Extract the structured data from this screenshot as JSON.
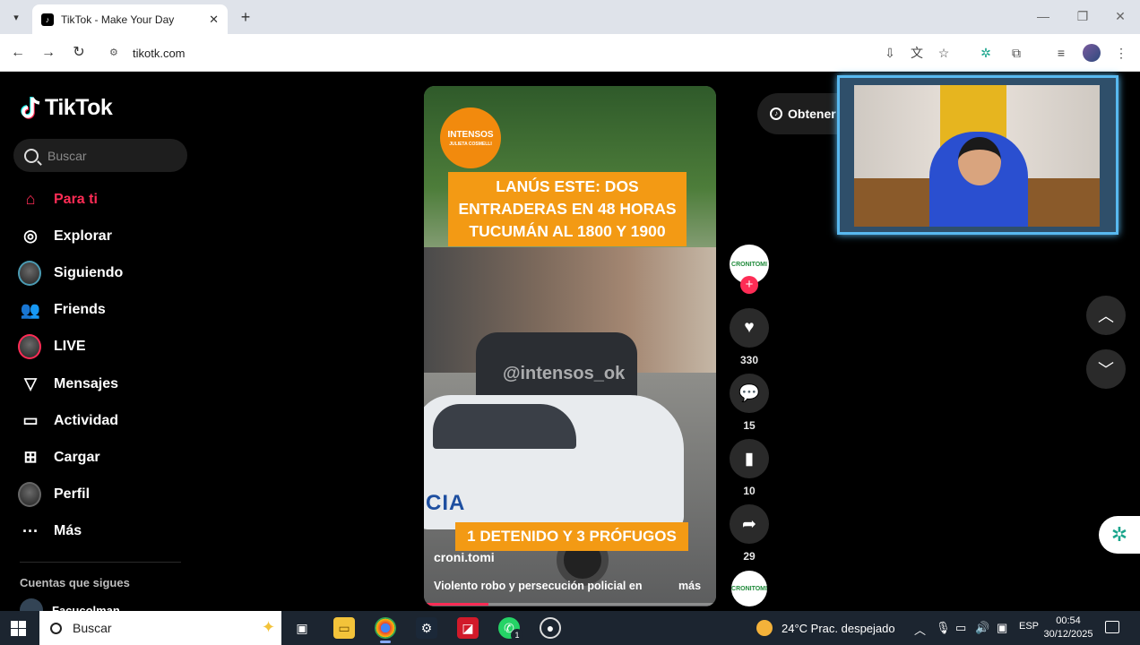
{
  "browser": {
    "tab_title": "TikTok - Make Your Day",
    "url": "tikotk.com"
  },
  "sidebar": {
    "logo": "TikTok",
    "search_placeholder": "Buscar",
    "items": [
      {
        "label": "Para ti",
        "icon": "home-icon",
        "active": true
      },
      {
        "label": "Explorar",
        "icon": "compass-icon"
      },
      {
        "label": "Siguiendo",
        "icon": "following-avatar-icon"
      },
      {
        "label": "Friends",
        "icon": "friends-icon"
      },
      {
        "label": "LIVE",
        "icon": "live-avatar-icon"
      },
      {
        "label": "Mensajes",
        "icon": "send-icon"
      },
      {
        "label": "Actividad",
        "icon": "activity-icon"
      },
      {
        "label": "Cargar",
        "icon": "upload-icon"
      },
      {
        "label": "Perfil",
        "icon": "profile-avatar-icon"
      },
      {
        "label": "Más",
        "icon": "more-icon"
      }
    ],
    "following_title": "Cuentas que sigues",
    "following_users": [
      "Facucolman"
    ]
  },
  "video": {
    "brand_badge": "INTENSOS",
    "brand_badge_sub": "JULIETA COSMELLI",
    "headline": "LANÚS ESTE: DOS ENTRADERAS EN 48 HORAS TUCUMÁN AL 1800 Y 1900",
    "watermark": "@intensos_ok",
    "police_text": "CIA",
    "lower_banner": "1 DETENIDO Y 3 PRÓFUGOS",
    "author": "croni.tomi",
    "description": "Violento robo y persecución policial en",
    "more_label": "más",
    "progress": 0.22
  },
  "actions": {
    "avatar_label": "CRONITOMI",
    "likes": "330",
    "comments": "15",
    "saves": "10",
    "shares": "29"
  },
  "get_app_label": "Obtener",
  "taskbar": {
    "search_placeholder": "Buscar",
    "weather": "24°C  Prac. despejado",
    "language": "ESP",
    "time": "00:54",
    "date": "30/12/2025",
    "whatsapp_badge": "1"
  },
  "colors": {
    "accent": "#fe2c55",
    "banner": "#f39a14",
    "webcam_border": "#58b9f0"
  }
}
